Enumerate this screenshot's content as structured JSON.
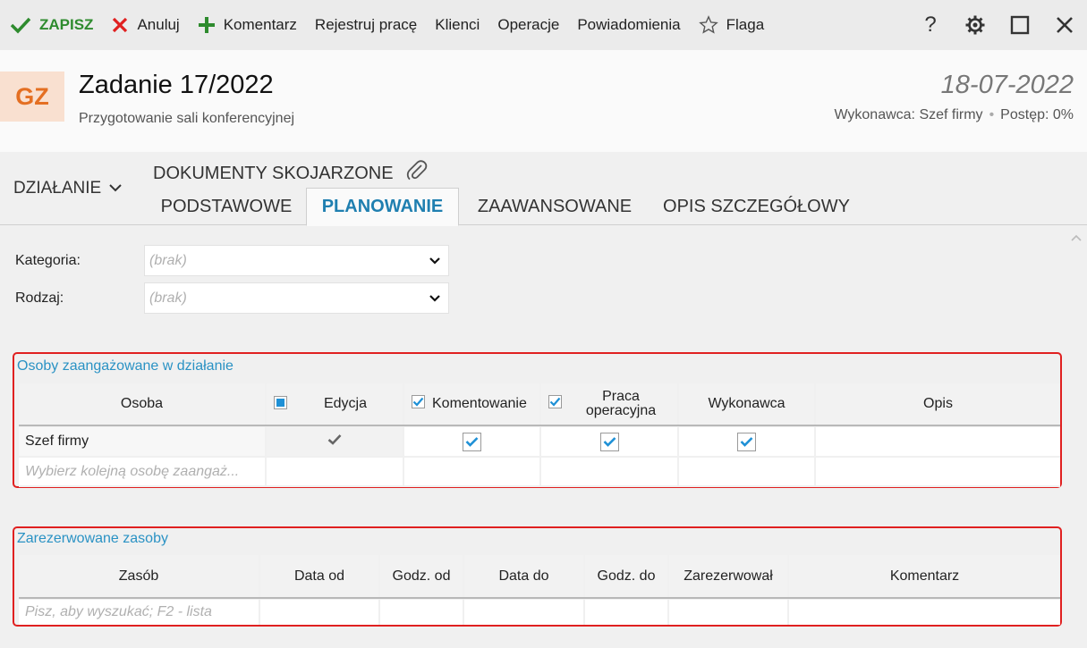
{
  "toolbar": {
    "save": "ZAPISZ",
    "cancel": "Anuluj",
    "comment": "Komentarz",
    "register_work": "Rejestruj pracę",
    "clients": "Klienci",
    "operations": "Operacje",
    "notifications": "Powiadomienia",
    "flag": "Flaga",
    "help": "?",
    "close": "✕"
  },
  "header": {
    "avatar": "GZ",
    "title": "Zadanie 17/2022",
    "subtitle": "Przygotowanie sali konferencyjnej",
    "date": "18-07-2022",
    "assignee": "Wykonawca: Szef firmy",
    "progress": "Postęp: 0%"
  },
  "nav": {
    "action_menu": "DZIAŁANIE",
    "linked_docs": "DOKUMENTY SKOJARZONE",
    "tabs": [
      "PODSTAWOWE",
      "PLANOWANIE",
      "ZAAWANSOWANE",
      "OPIS SZCZEGÓŁOWY"
    ],
    "active_tab": "PLANOWANIE"
  },
  "form": {
    "category_label": "Kategoria:",
    "category_value": "(brak)",
    "type_label": "Rodzaj:",
    "type_value": "(brak)"
  },
  "people_section": {
    "title": "Osoby zaangażowane w działanie",
    "columns": [
      "Osoba",
      "Edycja",
      "Komentowanie",
      "Praca operacyjna",
      "Wykonawca",
      "Opis"
    ],
    "rows": [
      {
        "person": "Szef firmy",
        "edit": true,
        "comment": true,
        "operational": true,
        "assignee": true,
        "description": ""
      }
    ],
    "new_row_placeholder": "Wybierz kolejną osobę zaangaż..."
  },
  "resources_section": {
    "title": "Zarezerwowane zasoby",
    "columns": [
      "Zasób",
      "Data od",
      "Godz. od",
      "Data do",
      "Godz. do",
      "Zarezerwował",
      "Komentarz"
    ],
    "new_row_placeholder": "Pisz, aby wyszukać; F2 - lista"
  },
  "colors": {
    "accent": "#1f7fb0",
    "section_title": "#2a92c4",
    "highlight_border": "#e02020",
    "save_green": "#2e8b2e",
    "avatar_orange": "#e46f22",
    "checkbox_blue": "#1e90d6"
  },
  "icons": [
    "check-icon",
    "x-icon",
    "plus-icon",
    "star-icon",
    "gear-icon",
    "maximize-icon",
    "close-icon",
    "chevron-down-icon",
    "paperclip-icon",
    "checkmark-icon"
  ]
}
